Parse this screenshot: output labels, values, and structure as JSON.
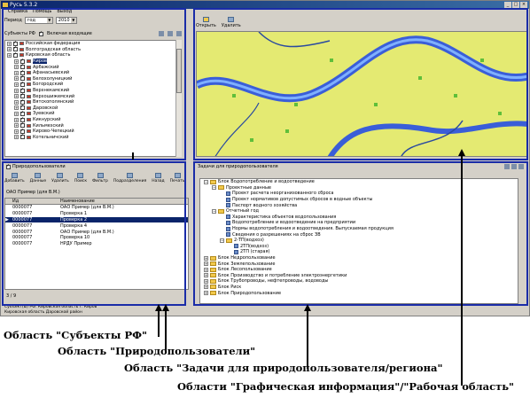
{
  "app": {
    "title": "Русь 5.3.2",
    "menu": [
      "Справка",
      "Помощь",
      "Выход"
    ]
  },
  "subjects": {
    "period_label": "Период",
    "period_value": "год",
    "year_value": "2010",
    "header": "Субъекты РФ",
    "include_label": "Включая входящие",
    "tree": [
      {
        "label": "Российская федерация",
        "level": 0
      },
      {
        "label": "Волгоградская область",
        "level": 0
      },
      {
        "label": "Кировская область",
        "level": 0
      },
      {
        "label": "Киров",
        "level": 1,
        "selected": true
      },
      {
        "label": "Арбажский",
        "level": 1
      },
      {
        "label": "Афанасьевский",
        "level": 1
      },
      {
        "label": "Белохолуницкий",
        "level": 1
      },
      {
        "label": "Богородский",
        "level": 1
      },
      {
        "label": "Верхнекамский",
        "level": 1
      },
      {
        "label": "Верхошижемский",
        "level": 1
      },
      {
        "label": "Вятскополянский",
        "level": 1
      },
      {
        "label": "Даровской",
        "level": 1
      },
      {
        "label": "Зуевский",
        "level": 1
      },
      {
        "label": "Кикнурский",
        "level": 1
      },
      {
        "label": "Кильмезский",
        "level": 1
      },
      {
        "label": "Кирово-Чепецкий",
        "level": 1
      },
      {
        "label": "Котельничский",
        "level": 1
      }
    ]
  },
  "users": {
    "title": "Природопользователи",
    "toolbar": [
      "Добавить",
      "Данные",
      "Удалить",
      "Поиск",
      "Фильтр",
      "Подразделения",
      "Назад",
      "Печать"
    ],
    "selected_caption": "ОАО Пример (для В.М.)",
    "columns": [
      "Ид",
      "Наименование"
    ],
    "rows": [
      {
        "id": "0000077",
        "name": "ОАО Пример (для В.М.)",
        "sel": false
      },
      {
        "id": "0000077",
        "name": "Проверка 1",
        "sel": false
      },
      {
        "id": "0000077",
        "name": "Проверка 2",
        "sel": true
      },
      {
        "id": "0000077",
        "name": "Проверка 4",
        "sel": false
      },
      {
        "id": "0000077",
        "name": "ОАО Пример (для В.М.)",
        "sel": false
      },
      {
        "id": "0000077",
        "name": "Проверка 10",
        "sel": false
      },
      {
        "id": "0000077",
        "name": "НРДУ Пример",
        "sel": false
      }
    ],
    "pager": "3 / 9"
  },
  "map": {
    "toolbar": [
      "Открыть",
      "Удалить"
    ]
  },
  "tasks": {
    "title": "Задачи для природопользователя",
    "tree": [
      {
        "label": "Блок Водопотребление и водоотведение",
        "level": 0,
        "kind": "folder"
      },
      {
        "label": "Проектные данные",
        "level": 1,
        "kind": "folder"
      },
      {
        "label": "Проект расчета неорганизованного сброса",
        "level": 2,
        "kind": "doc"
      },
      {
        "label": "Проект нормативов допустимых сбросов в водные объекты",
        "level": 2,
        "kind": "doc"
      },
      {
        "label": "Паспорт водного хозяйства",
        "level": 2,
        "kind": "doc"
      },
      {
        "label": "Отчетный год",
        "level": 1,
        "kind": "folder"
      },
      {
        "label": "Характеристика объектов водопользования",
        "level": 2,
        "kind": "doc"
      },
      {
        "label": "Водопотребление и водоотведение на предприятии",
        "level": 2,
        "kind": "doc"
      },
      {
        "label": "Нормы водопотребления и водоотведения. Выпускаемая продукция",
        "level": 2,
        "kind": "doc"
      },
      {
        "label": "Сведения о разрешениях на сброс ЗВ",
        "level": 2,
        "kind": "doc"
      },
      {
        "label": "2-ТП(водхоз)",
        "level": 2,
        "kind": "folder"
      },
      {
        "label": "2ТП(водхоз)",
        "level": 3,
        "kind": "doc"
      },
      {
        "label": "2ТП (старая)",
        "level": 3,
        "kind": "doc"
      },
      {
        "label": "Блок Недропользование",
        "level": 0,
        "kind": "folder"
      },
      {
        "label": "Блок Землепользование",
        "level": 0,
        "kind": "folder"
      },
      {
        "label": "Блок Лесопользование",
        "level": 0,
        "kind": "folder"
      },
      {
        "label": "Блок Производство и потребление электроэнергетики",
        "level": 0,
        "kind": "folder"
      },
      {
        "label": "Блок Трубопроводы, нефтепроводы, водоводы",
        "level": 0,
        "kind": "folder"
      },
      {
        "label": "Блок Риск",
        "level": 0,
        "kind": "folder"
      },
      {
        "label": "Блок Природопользование",
        "level": 0,
        "kind": "folder"
      }
    ]
  },
  "status": {
    "line1": "Субъект(ы) РФ: Кировская область г. Киров",
    "line2": "Кировская область Даровской район"
  },
  "annotations": {
    "a1": "Область \"Субъекты РФ\"",
    "a2": "Область \"Природопользователи\"",
    "a3": "Область \"Задачи для природопользователя/региона\"",
    "a4": "Области \"Графическая информация\"/\"Рабочая область\""
  }
}
